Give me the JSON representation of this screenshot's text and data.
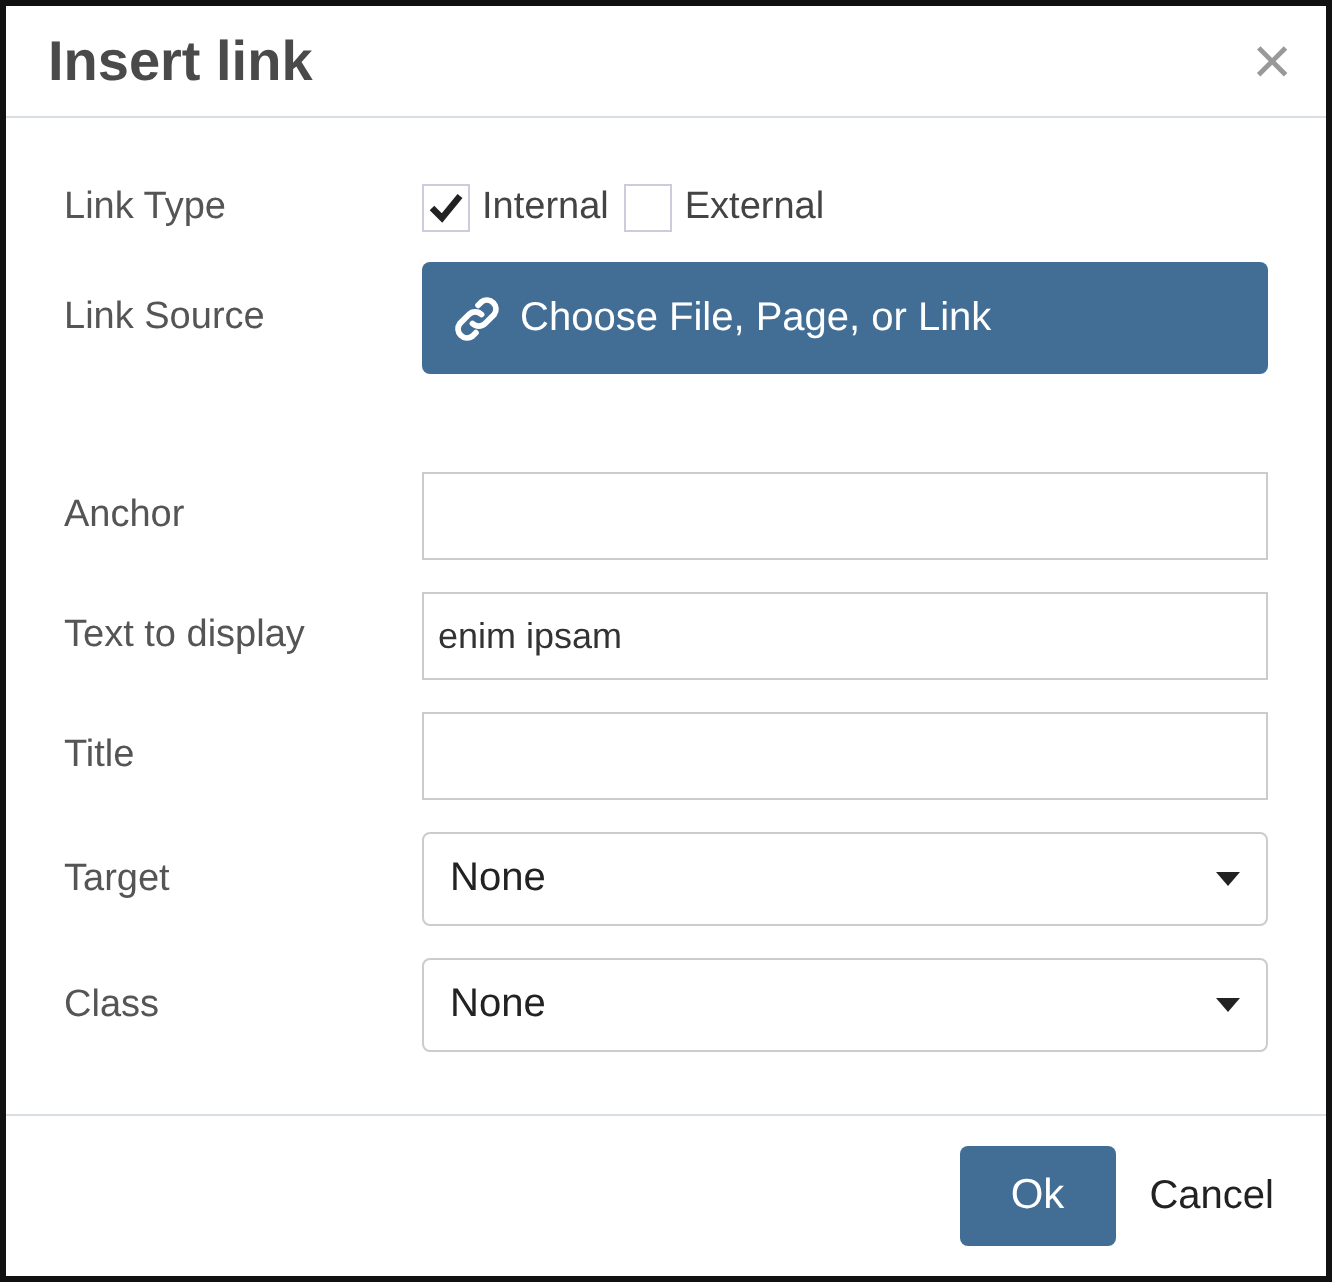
{
  "dialog": {
    "title": "Insert link",
    "close": "×"
  },
  "link_type": {
    "label": "Link Type",
    "options": [
      {
        "label": "Internal",
        "checked": true
      },
      {
        "label": "External",
        "checked": false
      }
    ]
  },
  "link_source": {
    "label": "Link Source",
    "button": "Choose File, Page, or Link"
  },
  "fields": [
    {
      "kind": "text",
      "label": "Anchor"
    },
    {
      "kind": "text",
      "label": "Text to display",
      "value": "enim ipsam"
    },
    {
      "kind": "text",
      "label": "Title"
    },
    {
      "kind": "select",
      "label": "Target",
      "value": "None"
    },
    {
      "kind": "select",
      "label": "Class",
      "value": "None"
    }
  ],
  "buttons": {
    "ok": "Ok",
    "cancel": "Cancel"
  }
}
